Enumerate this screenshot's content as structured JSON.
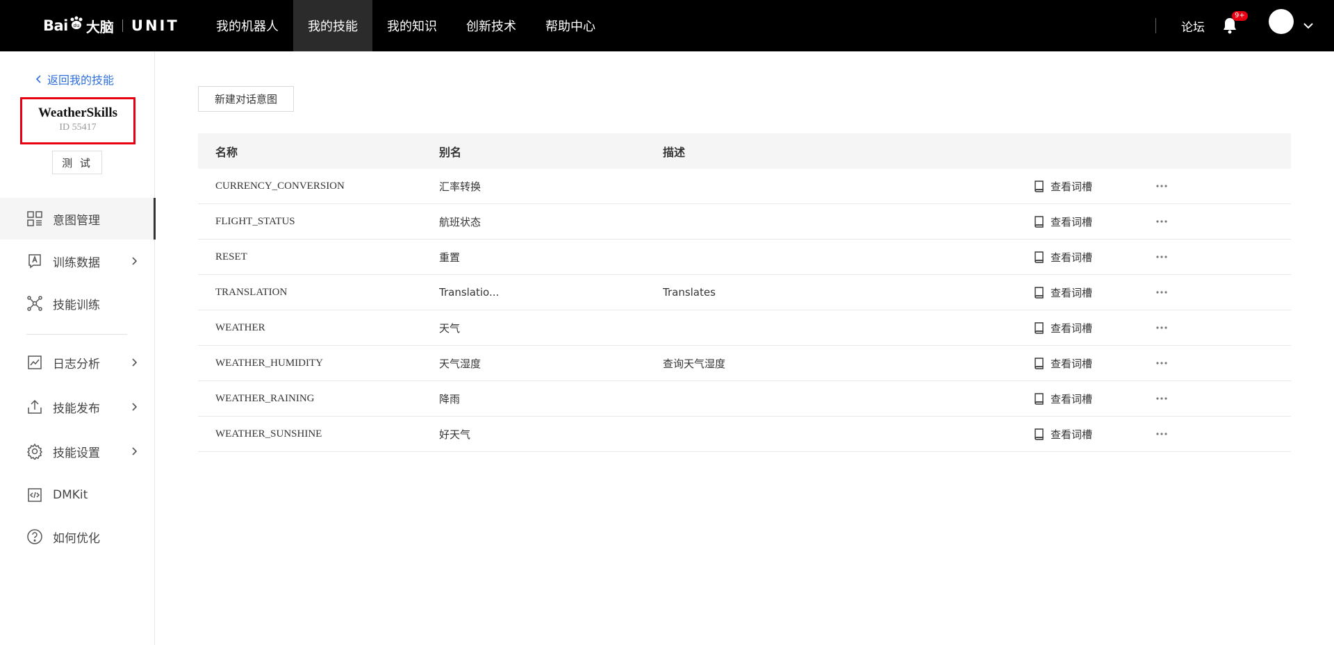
{
  "header": {
    "logo": {
      "bai": "Bai",
      "brain": "大脑",
      "unit": "UNIT"
    },
    "nav": [
      {
        "label": "我的机器人",
        "active": false
      },
      {
        "label": "我的技能",
        "active": true
      },
      {
        "label": "我的知识",
        "active": false
      },
      {
        "label": "创新技术",
        "active": false
      },
      {
        "label": "帮助中心",
        "active": false
      }
    ],
    "forum": "论坛",
    "notification_badge": "9+"
  },
  "sidebar": {
    "back_label": "返回我的技能",
    "skill_name": "WeatherSkills",
    "skill_id": "ID 55417",
    "test_label": "测 试",
    "items": [
      {
        "label": "意图管理",
        "icon": "intent-icon",
        "active": true,
        "has_arrow": false
      },
      {
        "label": "训练数据",
        "icon": "training-data-icon",
        "active": false,
        "has_arrow": true
      },
      {
        "label": "技能训练",
        "icon": "network-icon",
        "active": false,
        "has_arrow": false
      },
      {
        "label": "日志分析",
        "icon": "chart-icon",
        "active": false,
        "has_arrow": true
      },
      {
        "label": "技能发布",
        "icon": "upload-icon",
        "active": false,
        "has_arrow": true
      },
      {
        "label": "技能设置",
        "icon": "gear-icon",
        "active": false,
        "has_arrow": true
      },
      {
        "label": "DMKit",
        "icon": "code-icon",
        "active": false,
        "has_arrow": false
      },
      {
        "label": "如何优化",
        "icon": "help-icon",
        "active": false,
        "has_arrow": false
      }
    ]
  },
  "main": {
    "new_intent_button": "新建对话意图",
    "table": {
      "columns": {
        "name": "名称",
        "alias": "别名",
        "desc": "描述"
      },
      "slot_label": "查看词槽",
      "rows": [
        {
          "name": "CURRENCY_CONVERSION",
          "alias": "汇率转换",
          "desc": ""
        },
        {
          "name": "FLIGHT_STATUS",
          "alias": "航班状态",
          "desc": ""
        },
        {
          "name": "RESET",
          "alias": "重置",
          "desc": ""
        },
        {
          "name": "TRANSLATION",
          "alias": "Translatio...",
          "desc": "Translates"
        },
        {
          "name": "WEATHER",
          "alias": "天气",
          "desc": ""
        },
        {
          "name": "WEATHER_HUMIDITY",
          "alias": "天气湿度",
          "desc": "查询天气湿度"
        },
        {
          "name": "WEATHER_RAINING",
          "alias": "降雨",
          "desc": ""
        },
        {
          "name": "WEATHER_SUNSHINE",
          "alias": "好天气",
          "desc": ""
        }
      ]
    }
  }
}
